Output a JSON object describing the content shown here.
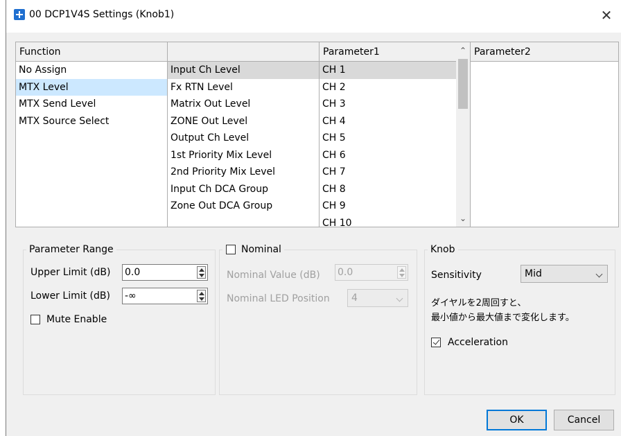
{
  "window": {
    "title": "00 DCP1V4S Settings (Knob1)"
  },
  "columns": {
    "function": {
      "header": "Function",
      "items": [
        "No Assign",
        "MTX Level",
        "MTX Send Level",
        "MTX Source Select"
      ]
    },
    "sub": {
      "header": "",
      "items": [
        "Input Ch Level",
        "Fx RTN Level",
        "Matrix Out Level",
        "ZONE Out Level",
        "Output Ch Level",
        "1st Priority Mix Level",
        "2nd Priority Mix Level",
        "Input Ch DCA Group",
        "Zone Out DCA Group"
      ]
    },
    "parameter1": {
      "header": "Parameter1",
      "items": [
        "CH 1",
        "CH 2",
        "CH 3",
        "CH 4",
        "CH 5",
        "CH 6",
        "CH 7",
        "CH 8",
        "CH 9",
        "CH 10"
      ]
    },
    "parameter2": {
      "header": "Parameter2",
      "items": []
    }
  },
  "parameter_range": {
    "title": "Parameter Range",
    "upper_label": "Upper Limit (dB)",
    "upper_value": "0.0",
    "lower_label": "Lower Limit (dB)",
    "lower_value": "-∞",
    "mute_label": "Mute Enable",
    "mute_checked": false
  },
  "nominal": {
    "title": "Nominal",
    "checked": false,
    "value_label": "Nominal Value (dB)",
    "value": "0.0",
    "led_label": "Nominal LED Position",
    "led_value": "4"
  },
  "knob": {
    "title": "Knob",
    "sensitivity_label": "Sensitivity",
    "sensitivity_value": "Mid",
    "note_line1": "ダイヤルを2周回すと、",
    "note_line2": "最小値から最大値まで変化します。",
    "acceleration_label": "Acceleration",
    "acceleration_checked": true
  },
  "buttons": {
    "ok": "OK",
    "cancel": "Cancel"
  },
  "colors": {
    "selection_light": "#cce8ff",
    "selection_gray": "#d9d9d9",
    "accent": "#0078d7"
  }
}
